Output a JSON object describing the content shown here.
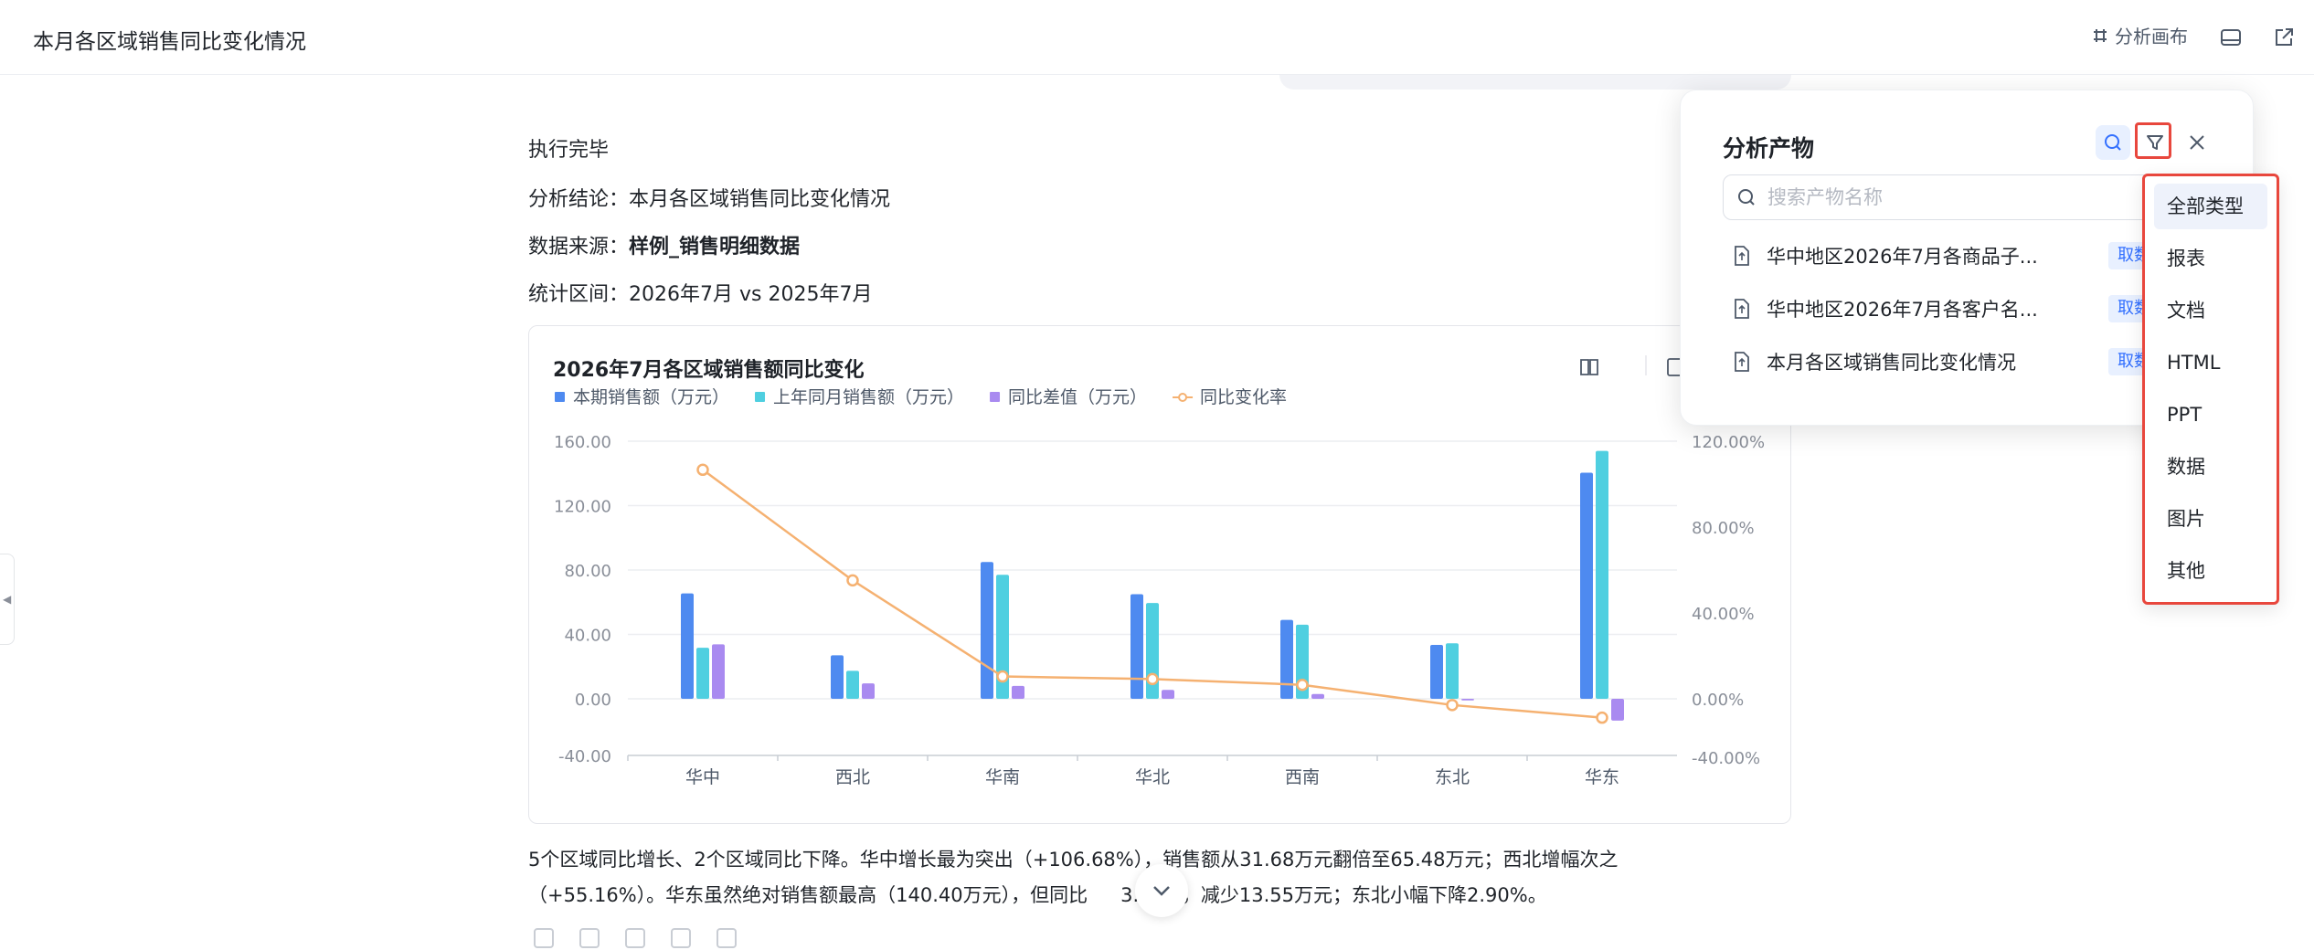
{
  "header": {
    "title": "本月各区域销售同比变化情况",
    "canvas_label": "分析画布"
  },
  "content": {
    "status": "执行完毕",
    "conclusion_label": "分析结论：",
    "conclusion_value": "本月各区域销售同比变化情况",
    "source_label": "数据来源：",
    "source_value": "样例_销售明细数据",
    "period_label": "统计区间：",
    "period_value": "2026年7月 vs 2025年7月",
    "summary_line1": "5个区域同比增长、2个区域同比下降。华中增长最为突出（+106.68%），销售额从31.68万元翻倍至65.48万元；西北增幅次之",
    "summary_line2": "（+55.16%）。华东虽然绝对销售额最高（140.40万元），但同比",
    "summary_line2b": "3.80%，减少13.55万元；东北小幅下降2.90%。"
  },
  "chart_data": {
    "type": "bar",
    "title": "2026年7月各区域销售额同比变化",
    "categories": [
      "华中",
      "西北",
      "华南",
      "华北",
      "西南",
      "东北",
      "华东"
    ],
    "series": [
      {
        "name": "本期销售额（万元）",
        "type": "bar",
        "color": "#4e8af0",
        "values": [
          65.48,
          27.0,
          85.0,
          65.0,
          49.0,
          33.5,
          140.4
        ]
      },
      {
        "name": "上年同月销售额（万元）",
        "type": "bar",
        "color": "#4fcfe0",
        "values": [
          31.68,
          17.4,
          77.0,
          59.5,
          46.0,
          34.5,
          153.95
        ]
      },
      {
        "name": "同比差值（万元）",
        "type": "bar",
        "color": "#a98af0",
        "values": [
          33.8,
          9.6,
          8.0,
          5.5,
          3.0,
          -1.0,
          -13.55
        ]
      },
      {
        "name": "同比变化率",
        "type": "line",
        "color": "#f5b171",
        "values": [
          106.68,
          55.16,
          10.4,
          9.2,
          6.5,
          -2.9,
          -8.8
        ]
      }
    ],
    "y_left": {
      "min": -40,
      "max": 160,
      "ticks": [
        "160.00",
        "120.00",
        "80.00",
        "40.00",
        "0.00",
        "-40.00"
      ]
    },
    "y_right": {
      "min": -40,
      "max": 120,
      "ticks": [
        "120.00%",
        "80.00%",
        "40.00%",
        "0.00%",
        "-40.00%"
      ]
    },
    "grid": true,
    "legend_position": "top-left"
  },
  "panel": {
    "title": "分析产物",
    "search_placeholder": "搜索产物名称",
    "items": [
      {
        "name": "华中地区2026年7月各商品子...",
        "tag": "取数数据"
      },
      {
        "name": "华中地区2026年7月各客户名...",
        "tag": "取数数据"
      },
      {
        "name": "本月各区域销售同比变化情况",
        "tag": "取数数据"
      }
    ]
  },
  "dropdown": {
    "options": [
      "全部类型",
      "报表",
      "文档",
      "HTML",
      "PPT",
      "数据",
      "图片",
      "其他"
    ],
    "selected": "全部类型"
  },
  "colors": {
    "accent": "#3370ff",
    "highlight": "#e8473d"
  }
}
